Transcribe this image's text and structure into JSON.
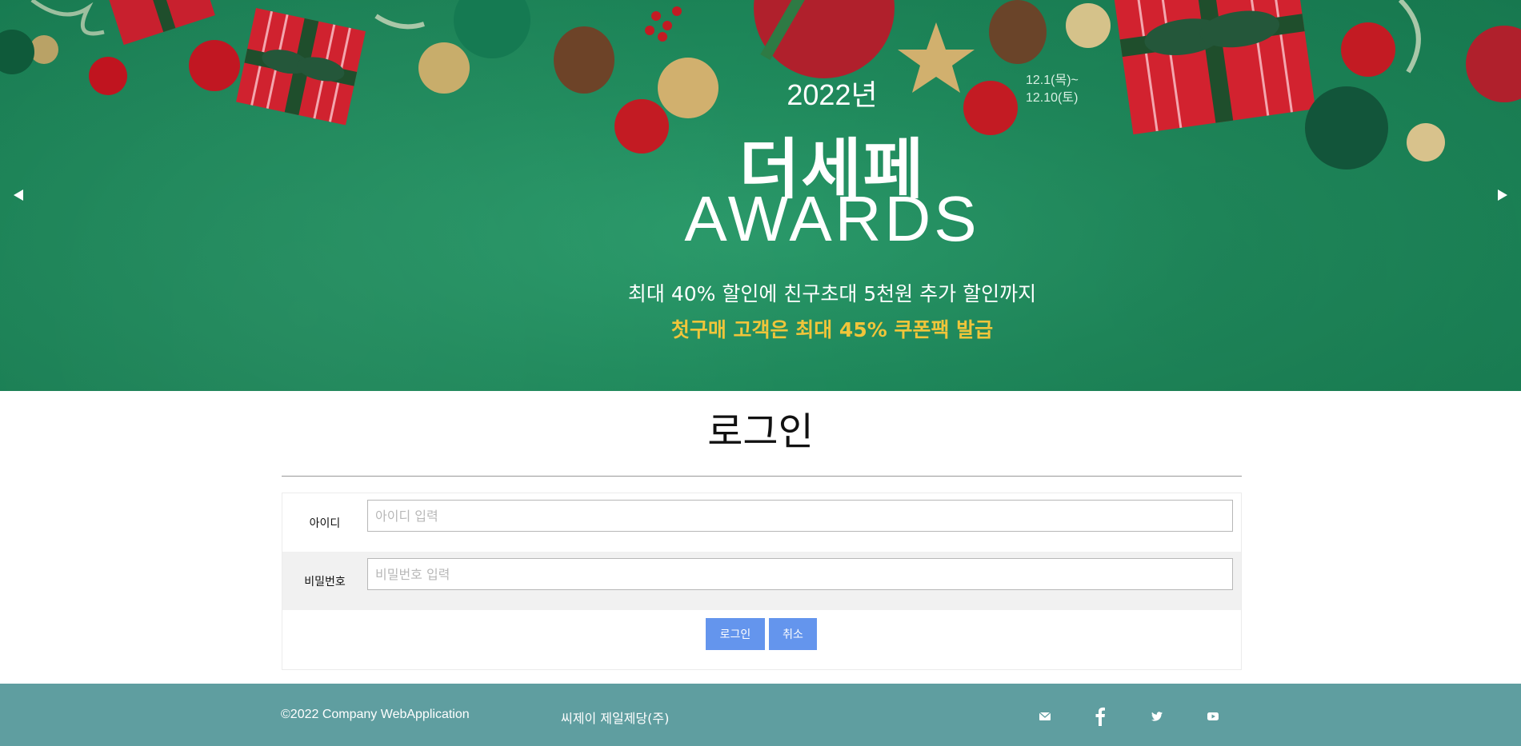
{
  "banner": {
    "year": "2022년",
    "dates_line1": "12.1(목)~",
    "dates_line2": "12.10(토)",
    "title": "더세페",
    "subtitle": "AWARDS",
    "line1": "최대 40% 할인에 친구초대 5천원 추가 할인까지",
    "line2": "첫구매 고객은 최대 45% 쿠폰팩 발급",
    "colors": {
      "background": "#1f8a5c",
      "highlight": "#f0c53a"
    }
  },
  "login": {
    "title": "로그인",
    "id_label": "아이디",
    "id_placeholder": "아이디 입력",
    "pw_label": "비밀번호",
    "pw_placeholder": "비밀번호 입력",
    "login_button": "로그인",
    "cancel_button": "취소",
    "button_color": "#6495ed"
  },
  "footer": {
    "copyright": "©2022 Company WebApplication",
    "company": "씨제이 제일제당(주)",
    "icons": [
      "mail-icon",
      "facebook-icon",
      "twitter-icon",
      "youtube-icon"
    ],
    "background": "#5f9ea0"
  }
}
